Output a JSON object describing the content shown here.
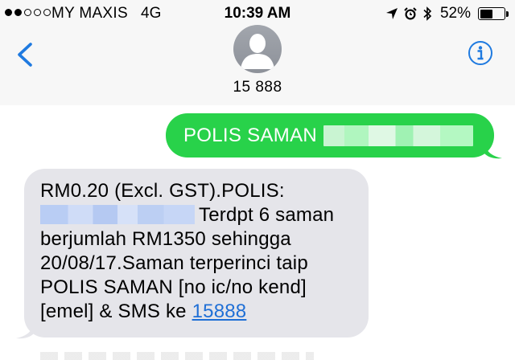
{
  "status_bar": {
    "carrier": "MY MAXIS",
    "network": "4G",
    "time": "10:39 AM",
    "battery_percent": "52%",
    "battery_level": 0.52,
    "signal_bars_filled": 2,
    "signal_bars_total": 5
  },
  "header": {
    "back_icon": "chevron-left-icon",
    "contact_name": "15 888",
    "info_icon": "info-icon",
    "avatar_icon": "person-silhouette-icon"
  },
  "messages": {
    "sent": {
      "text": "POLIS SAMAN",
      "redacted": true
    },
    "received": {
      "line1": "RM0.20 (Excl. GST).POLIS:",
      "line2_after_redaction": "Terdpt 6 saman",
      "line3": "berjumlah RM1350 sehingga",
      "line4": "20/08/17.Saman terperinci taip",
      "line5": "POLIS SAMAN [no ic/no kend]",
      "line6_prefix": "[emel] & SMS ke ",
      "link_text": "15888"
    }
  },
  "colors": {
    "header_bg": "#f7f7f7",
    "sent_bubble": "#28d24a",
    "received_bubble": "#e5e5ea",
    "accent_blue": "#1f7ae0",
    "link": "#1f6fd6"
  }
}
